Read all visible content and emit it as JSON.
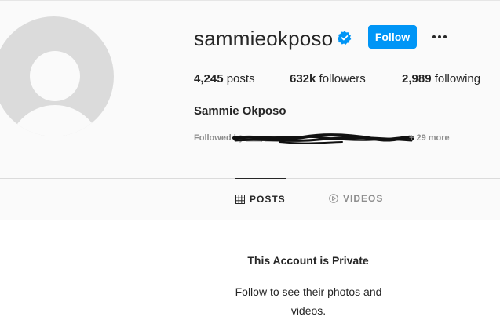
{
  "profile": {
    "username": "sammieokposo",
    "full_name": "Sammie Okposo",
    "verified": true,
    "follow_label": "Follow",
    "posts_count": "4,245",
    "posts_label": "posts",
    "followers_count": "632k",
    "followers_label": "followers",
    "following_count": "2,989",
    "following_label": "following",
    "followed_by_label": "Followed by",
    "followed_by_names": "___, ___, ___",
    "followed_by_more": "+ 29 more"
  },
  "tabs": [
    {
      "label": "POSTS",
      "icon": "grid-icon",
      "active": true
    },
    {
      "label": "VIDEOS",
      "icon": "play-circle-icon",
      "active": false
    }
  ],
  "private_notice": {
    "title": "This Account is Private",
    "subtitle": "Follow to see their photos and videos."
  },
  "colors": {
    "accent": "#0095f6",
    "text": "#262626",
    "muted": "#8e8e8e",
    "background_top": "#fafafa"
  }
}
